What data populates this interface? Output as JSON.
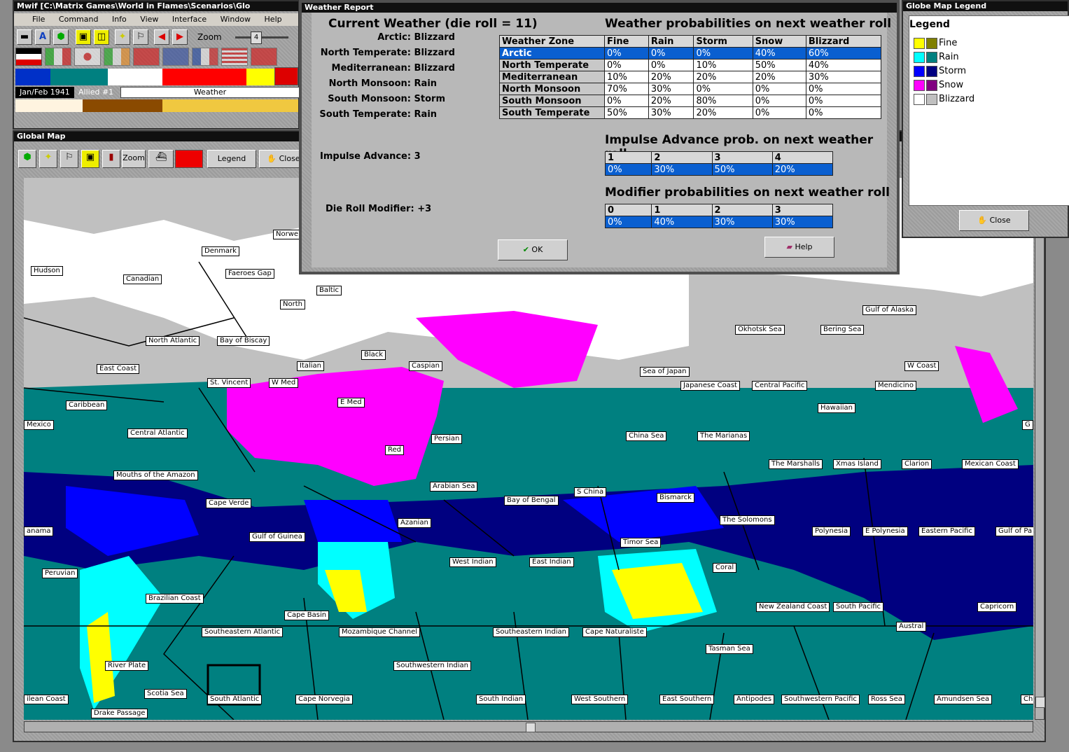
{
  "main_window": {
    "title": "Mwif [C:\\Matrix Games\\World in Flames\\Scenarios\\Glo",
    "menu": [
      "File",
      "Command",
      "Info",
      "View",
      "Interface",
      "Window",
      "Help"
    ],
    "zoom_label": "Zoom",
    "zoom_value": "4",
    "date": "Jan/Feb 1941",
    "side": "Allied #1",
    "phase": "Weather"
  },
  "global_map": {
    "title": "Global Map",
    "zoom_label": "Zoom",
    "legend_button": "Legend",
    "close_button": "Close",
    "colors": {
      "fine": "#ffff00",
      "rain": "#008080",
      "rain_light": "#00ffff",
      "storm": "#0000ff",
      "storm_dark": "#000080",
      "snow": "#ff00ff",
      "blizzard": "#ffffff",
      "blizzard_gray": "#c0c0c0"
    },
    "sea_labels": [
      "Hudson",
      "Canadian",
      "Denmark",
      "Faeroes Gap",
      "Norwe",
      "Baltic",
      "North",
      "North Atlantic",
      "Bay of Biscay",
      "East Coast",
      "Black",
      "Italian",
      "Caspian",
      "St. Vincent",
      "W Med",
      "Caribbean",
      "E Med",
      "Mexico",
      "Central Atlantic",
      "Persian",
      "Red",
      "Mouths of the Amazon",
      "Arabian Sea",
      "Cape Verde",
      "anama",
      "Gulf of Guinea",
      "Azanian",
      "Peruvian",
      "Brazilian Coast",
      "West Indian",
      "East Indian",
      "Cape Basin",
      "Southeastern Atlantic",
      "Mozambique Channel",
      "Southeastern Indian",
      "Cape Naturaliste",
      "River Plate",
      "Southwestern Indian",
      "Scotia Sea",
      "ilean Coast",
      "South Atlantic",
      "Cape Norvegia",
      "South Indian",
      "West Southern",
      "East Southern",
      "Antipodes",
      "Southwestern Pacific",
      "Ross Sea",
      "Amundsen Sea",
      "Chi",
      "Drake Passage",
      "Gulf of Alaska",
      "Okhotsk Sea",
      "Bering Sea",
      "W Coast",
      "Sea of Japan",
      "Japanese Coast",
      "Central Pacific",
      "Mendicino",
      "Hawaiian",
      "China Sea",
      "The Marianas",
      "The Marshalls",
      "Xmas Island",
      "Clarion",
      "Mexican Coast",
      "G",
      "S China",
      "Bismarck",
      "Bay of Bengal",
      "The Solomons",
      "Polynesia",
      "E Polynesia",
      "Eastern Pacific",
      "Gulf of Pa",
      "Timor Sea",
      "Coral",
      "New Zealand Coast",
      "South Pacific",
      "Capricorn",
      "Austral",
      "Tasman Sea"
    ]
  },
  "weather_report": {
    "title": "Weather Report",
    "current_heading": "Current Weather (die roll = 11)",
    "current": [
      {
        "zone": "Arctic:",
        "weather": "Blizzard"
      },
      {
        "zone": "North Temperate:",
        "weather": "Blizzard"
      },
      {
        "zone": "Mediterranean:",
        "weather": "Blizzard"
      },
      {
        "zone": "North Monsoon:",
        "weather": "Rain"
      },
      {
        "zone": "South Monsoon:",
        "weather": "Storm"
      },
      {
        "zone": "South Temperate:",
        "weather": "Rain"
      }
    ],
    "impulse_label": "Impulse Advance:",
    "impulse_value": "3",
    "modifier_label": "Die Roll Modifier:",
    "modifier_value": "+3",
    "prob_heading": "Weather probabilities on next weather roll",
    "prob_columns": [
      "Weather Zone",
      "Fine",
      "Rain",
      "Storm",
      "Snow",
      "Blizzard"
    ],
    "prob_rows": [
      {
        "zone": "Arctic",
        "vals": [
          "0%",
          "0%",
          "0%",
          "40%",
          "60%"
        ],
        "selected": true
      },
      {
        "zone": "North Temperate",
        "vals": [
          "0%",
          "0%",
          "10%",
          "50%",
          "40%"
        ],
        "selected": false
      },
      {
        "zone": "Mediterranean",
        "vals": [
          "10%",
          "20%",
          "20%",
          "20%",
          "30%"
        ],
        "selected": false
      },
      {
        "zone": "North Monsoon",
        "vals": [
          "70%",
          "30%",
          "0%",
          "0%",
          "0%"
        ],
        "selected": false
      },
      {
        "zone": "South Monsoon",
        "vals": [
          "0%",
          "20%",
          "80%",
          "0%",
          "0%"
        ],
        "selected": false
      },
      {
        "zone": "South Temperate",
        "vals": [
          "50%",
          "30%",
          "20%",
          "0%",
          "0%"
        ],
        "selected": false
      }
    ],
    "impulse_heading": "Impulse Advance prob. on next weather roll",
    "impulse_cols": [
      "1",
      "2",
      "3",
      "4"
    ],
    "impulse_vals": [
      "0%",
      "30%",
      "50%",
      "20%"
    ],
    "modifier_heading": "Modifier probabilities on next weather roll",
    "modifier_cols": [
      "0",
      "1",
      "2",
      "3"
    ],
    "modifier_vals": [
      "0%",
      "40%",
      "30%",
      "30%"
    ],
    "ok_button": "OK",
    "help_button": "Help"
  },
  "legend": {
    "title": "Globe Map Legend",
    "heading": "Legend",
    "items": [
      {
        "label": "Fine",
        "c1": "#ffff00",
        "c2": "#808000"
      },
      {
        "label": "Rain",
        "c1": "#00ffff",
        "c2": "#008080"
      },
      {
        "label": "Storm",
        "c1": "#0000ff",
        "c2": "#000080"
      },
      {
        "label": "Snow",
        "c1": "#ff00ff",
        "c2": "#800080"
      },
      {
        "label": "Blizzard",
        "c1": "#ffffff",
        "c2": "#c0c0c0"
      }
    ],
    "close_button": "Close"
  }
}
